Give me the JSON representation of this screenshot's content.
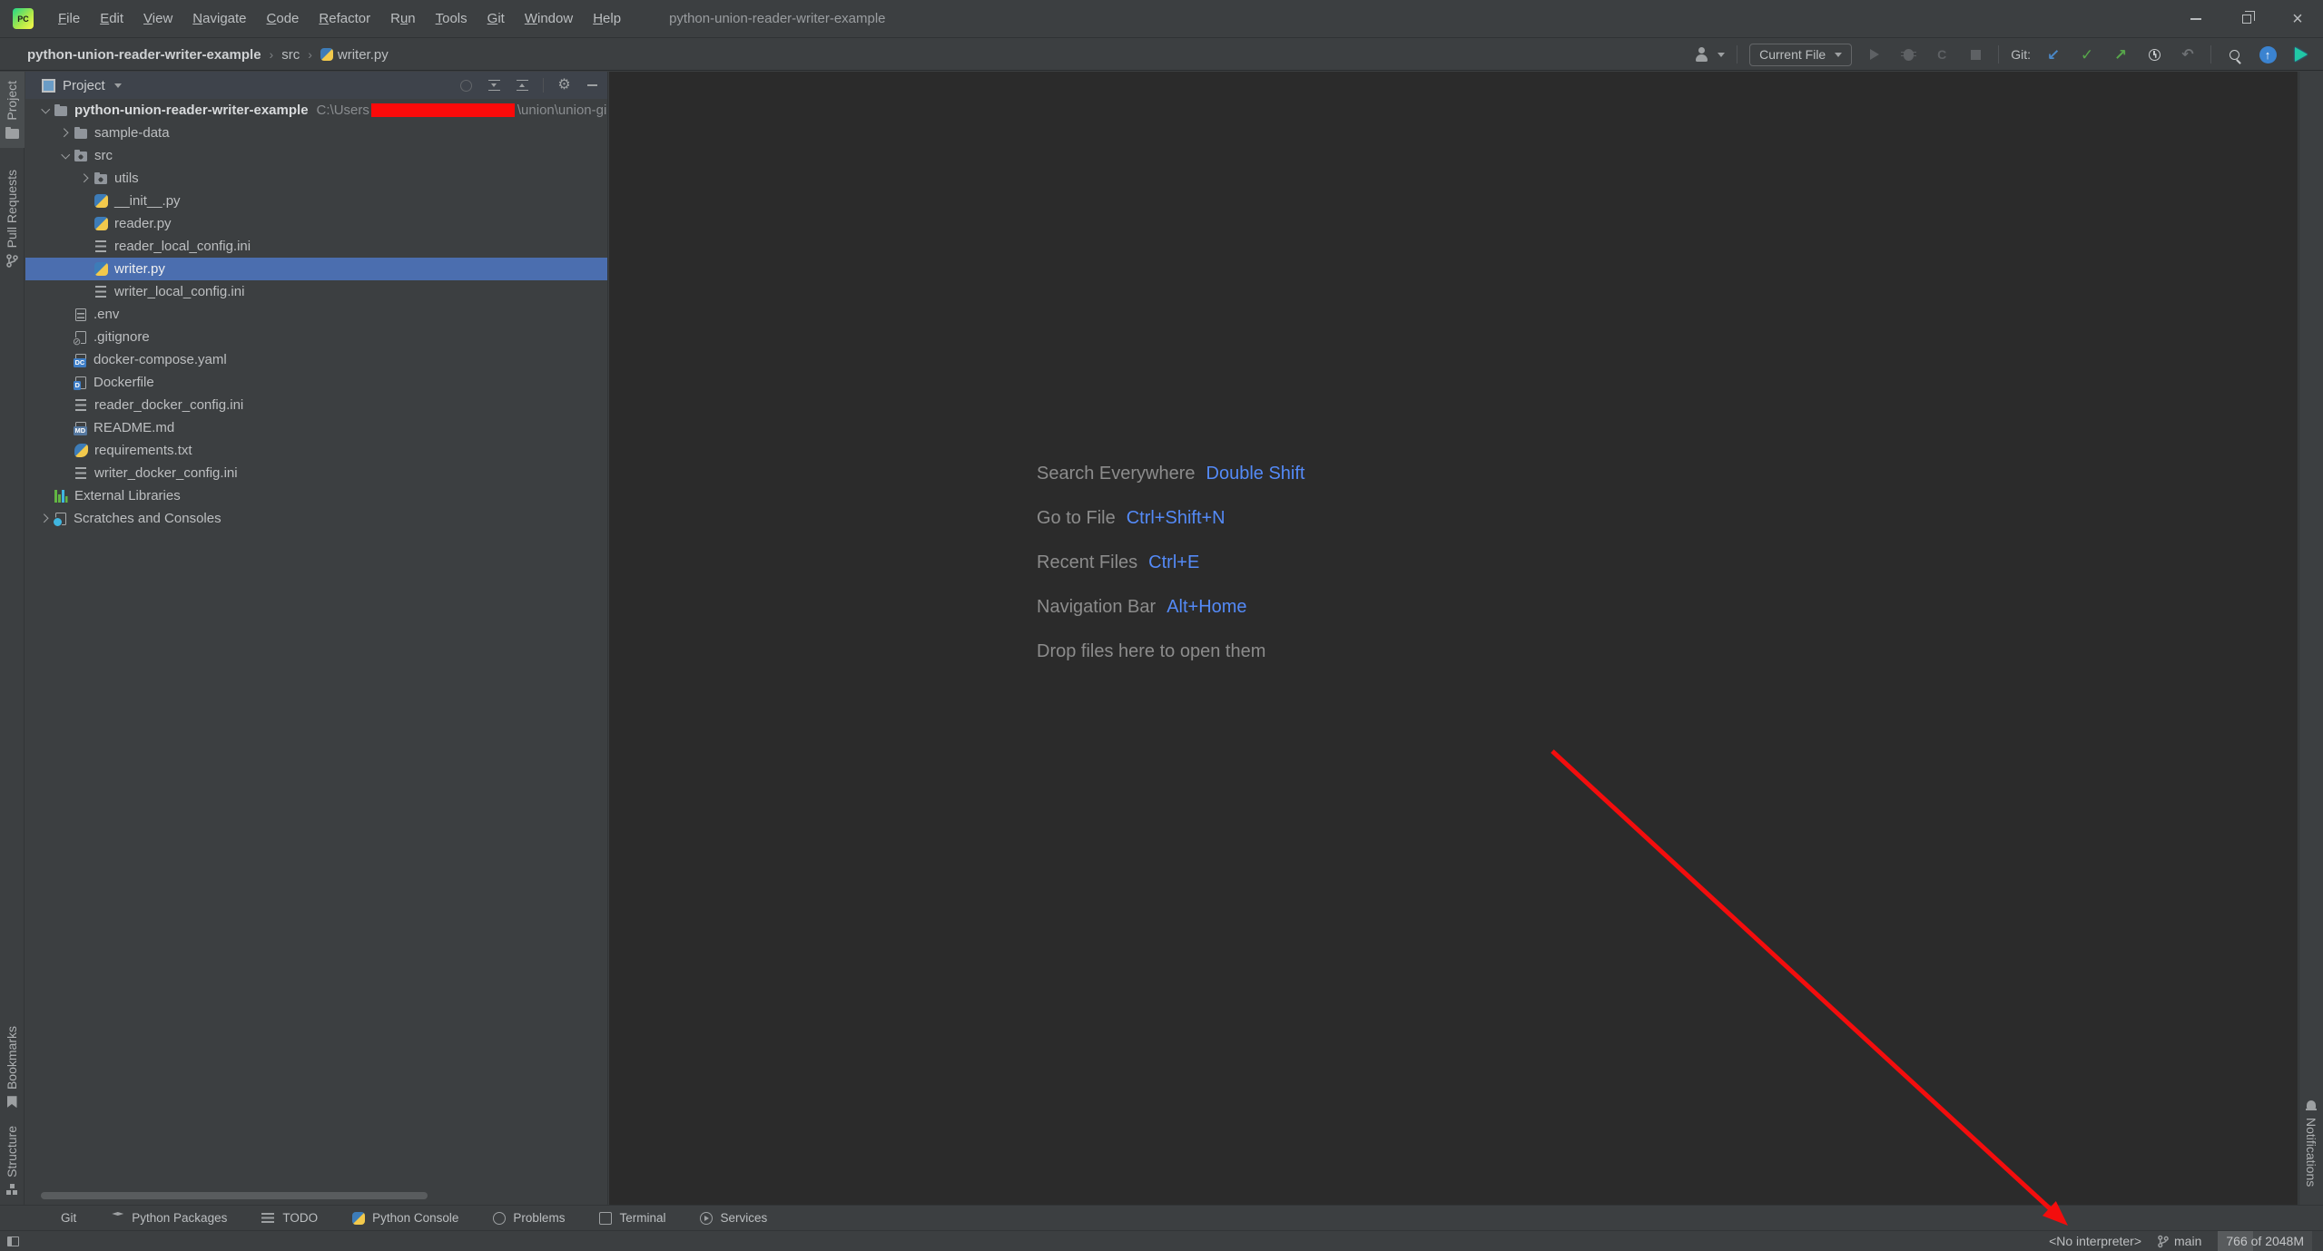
{
  "titlebar": {
    "title": "python-union-reader-writer-example",
    "logo_text": "PC",
    "menus": [
      {
        "label": "File",
        "mnemonic": 0
      },
      {
        "label": "Edit",
        "mnemonic": 0
      },
      {
        "label": "View",
        "mnemonic": 0
      },
      {
        "label": "Navigate",
        "mnemonic": 0
      },
      {
        "label": "Code",
        "mnemonic": 0
      },
      {
        "label": "Refactor",
        "mnemonic": 0
      },
      {
        "label": "Run",
        "mnemonic": 1
      },
      {
        "label": "Tools",
        "mnemonic": 0
      },
      {
        "label": "Git",
        "mnemonic": 0
      },
      {
        "label": "Window",
        "mnemonic": 0
      },
      {
        "label": "Help",
        "mnemonic": 0
      }
    ]
  },
  "breadcrumb": {
    "items": [
      "python-union-reader-writer-example",
      "src",
      "writer.py"
    ]
  },
  "toolbar": {
    "run_config": "Current File",
    "git_label": "Git:"
  },
  "stripe_tabs": {
    "project": "Project",
    "pull_requests": "Pull Requests",
    "bookmarks": "Bookmarks",
    "structure": "Structure",
    "notifications": "Notifications"
  },
  "project_panel": {
    "header": {
      "title": "Project"
    },
    "tree": {
      "items": [
        {
          "label": "python-union-reader-writer-example",
          "lvl": "lv0",
          "chev": "expanded",
          "icon": "ic-folder",
          "cls": "bold",
          "path_pre": "C:\\Users",
          "path_post": "\\union\\union-gi",
          "redacted": "on"
        },
        {
          "label": "sample-data",
          "lvl": "lv1",
          "chev": "collapsed",
          "icon": "ic-folder"
        },
        {
          "label": "src",
          "lvl": "lv1",
          "chev": "expanded",
          "icon": "ic-folder-src"
        },
        {
          "label": "utils",
          "lvl": "lv2",
          "chev": "collapsed",
          "icon": "ic-folder-src"
        },
        {
          "label": "__init__.py",
          "lvl": "lv2",
          "chev": "leaf",
          "icon": "ic-py"
        },
        {
          "label": "reader.py",
          "lvl": "lv2",
          "chev": "leaf",
          "icon": "ic-py"
        },
        {
          "label": "reader_local_config.ini",
          "lvl": "lv2",
          "chev": "leaf",
          "icon": "ic-ini"
        },
        {
          "label": "writer.py",
          "lvl": "lv2",
          "chev": "leaf",
          "icon": "ic-py",
          "cls": "selected"
        },
        {
          "label": "writer_local_config.ini",
          "lvl": "lv2",
          "chev": "leaf",
          "icon": "ic-ini"
        },
        {
          "label": ".env",
          "lvl": "lv1",
          "chev": "leaf",
          "icon": "ic-env",
          "cls2": "doc"
        },
        {
          "label": ".gitignore",
          "lvl": "lv1",
          "chev": "leaf",
          "icon": "ic-git",
          "cls2": "doc"
        },
        {
          "label": "docker-compose.yaml",
          "lvl": "lv1",
          "chev": "leaf",
          "icon": "ic-dc",
          "cls2": "doc badge"
        },
        {
          "label": "Dockerfile",
          "lvl": "lv1",
          "chev": "leaf",
          "icon": "ic-docker",
          "cls2": "doc badge"
        },
        {
          "label": "reader_docker_config.ini",
          "lvl": "lv1",
          "chev": "leaf",
          "icon": "ic-ini"
        },
        {
          "label": "README.md",
          "lvl": "lv1",
          "chev": "leaf",
          "icon": "ic-md",
          "cls2": "doc badge"
        },
        {
          "label": "requirements.txt",
          "lvl": "lv1",
          "chev": "leaf",
          "icon": "ic-req"
        },
        {
          "label": "writer_docker_config.ini",
          "lvl": "lv1",
          "chev": "leaf",
          "icon": "ic-ini"
        },
        {
          "label": "External Libraries",
          "lvl": "lv0",
          "chev": "leaf",
          "icon": "ic-libs"
        },
        {
          "label": "Scratches and Consoles",
          "lvl": "lv0",
          "chev": "collapsed",
          "icon": "ic-scratch"
        }
      ]
    }
  },
  "editor": {
    "shortcuts": [
      {
        "label": "Search Everywhere",
        "keys": "Double Shift"
      },
      {
        "label": "Go to File",
        "keys": "Ctrl+Shift+N"
      },
      {
        "label": "Recent Files",
        "keys": "Ctrl+E"
      },
      {
        "label": "Navigation Bar",
        "keys": "Alt+Home"
      }
    ],
    "drop_hint": "Drop files here to open them"
  },
  "bottom_bar": {
    "items": [
      {
        "label": "Git",
        "icon": "bb-git"
      },
      {
        "label": "Python Packages",
        "icon": "bb-pkg"
      },
      {
        "label": "TODO",
        "icon": "bb-todo"
      },
      {
        "label": "Python Console",
        "icon": "bb-pyc"
      },
      {
        "label": "Problems",
        "icon": "bb-prob"
      },
      {
        "label": "Terminal",
        "icon": "bb-term"
      },
      {
        "label": "Services",
        "icon": "bb-serv"
      }
    ]
  },
  "status_bar": {
    "interpreter": "<No interpreter>",
    "branch": "main",
    "memory": "766 of 2048M"
  },
  "colors": {
    "selection": "#4B6EAF",
    "shortcut_blue": "#548AF7",
    "redaction": "#FB0A0A",
    "arrow": "#F30D0D",
    "git_update": "#4A88C7",
    "git_commit": "#57A64A",
    "git_push": "#57A64A"
  }
}
